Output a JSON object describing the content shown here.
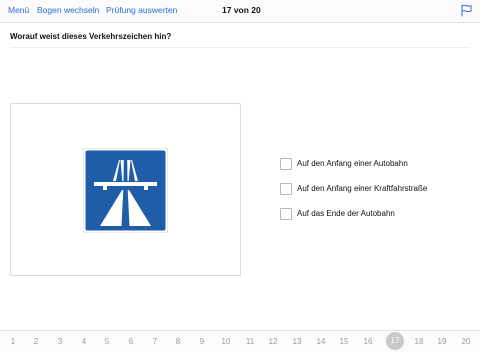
{
  "header": {
    "menu_label": "Menü",
    "switch_sheet_label": "Bogen wechseln",
    "evaluate_label": "Prüfung auswerten",
    "progress_text": "17 von 20",
    "flag_icon": "flag-icon"
  },
  "question": {
    "text": "Worauf weist dieses Verkehrszeichen hin?",
    "sign_icon": "autobahn-sign",
    "sign_color": "#1f5da9"
  },
  "answers": [
    {
      "label": "Auf den Anfang einer Autobahn",
      "checked": false
    },
    {
      "label": "Auf den Anfang einer Kraftfahrstraße",
      "checked": false
    },
    {
      "label": "Auf das Ende der Autobahn",
      "checked": false
    }
  ],
  "pager": {
    "pages": [
      "1",
      "2",
      "3",
      "4",
      "5",
      "6",
      "7",
      "8",
      "9",
      "10",
      "11",
      "12",
      "13",
      "14",
      "15",
      "16",
      "17",
      "18",
      "19",
      "20"
    ],
    "current": "17"
  },
  "colors": {
    "accent": "#2a6fd6",
    "current_page_bg": "#c8c8c8"
  }
}
